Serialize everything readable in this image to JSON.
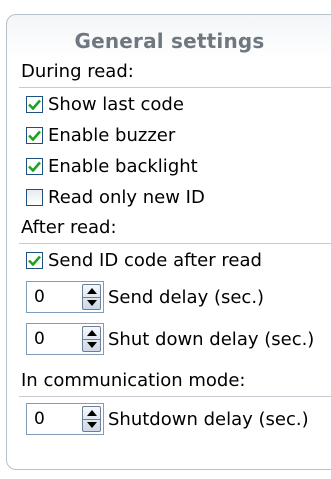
{
  "panel": {
    "title": "General settings"
  },
  "during_read": {
    "label": "During read:",
    "options": [
      {
        "label": "Show last code",
        "checked": true
      },
      {
        "label": "Enable buzzer",
        "checked": true
      },
      {
        "label": "Enable backlight",
        "checked": true
      },
      {
        "label": "Read only new ID",
        "checked": false
      }
    ]
  },
  "after_read": {
    "label": "After read:",
    "send_id": {
      "label": "Send ID code after read",
      "checked": true
    },
    "send_delay": {
      "value": "0",
      "label": "Send delay (sec.)"
    },
    "shut_down_delay": {
      "value": "0",
      "label": "Shut down delay (sec.)"
    }
  },
  "communication_mode": {
    "label": "In communication mode:",
    "shutdown_delay": {
      "value": "0",
      "label": "Shutdown delay (sec.)"
    }
  },
  "colors": {
    "check": "#1fa31f",
    "title": "#6f7880",
    "border": "#b8c1c8"
  }
}
